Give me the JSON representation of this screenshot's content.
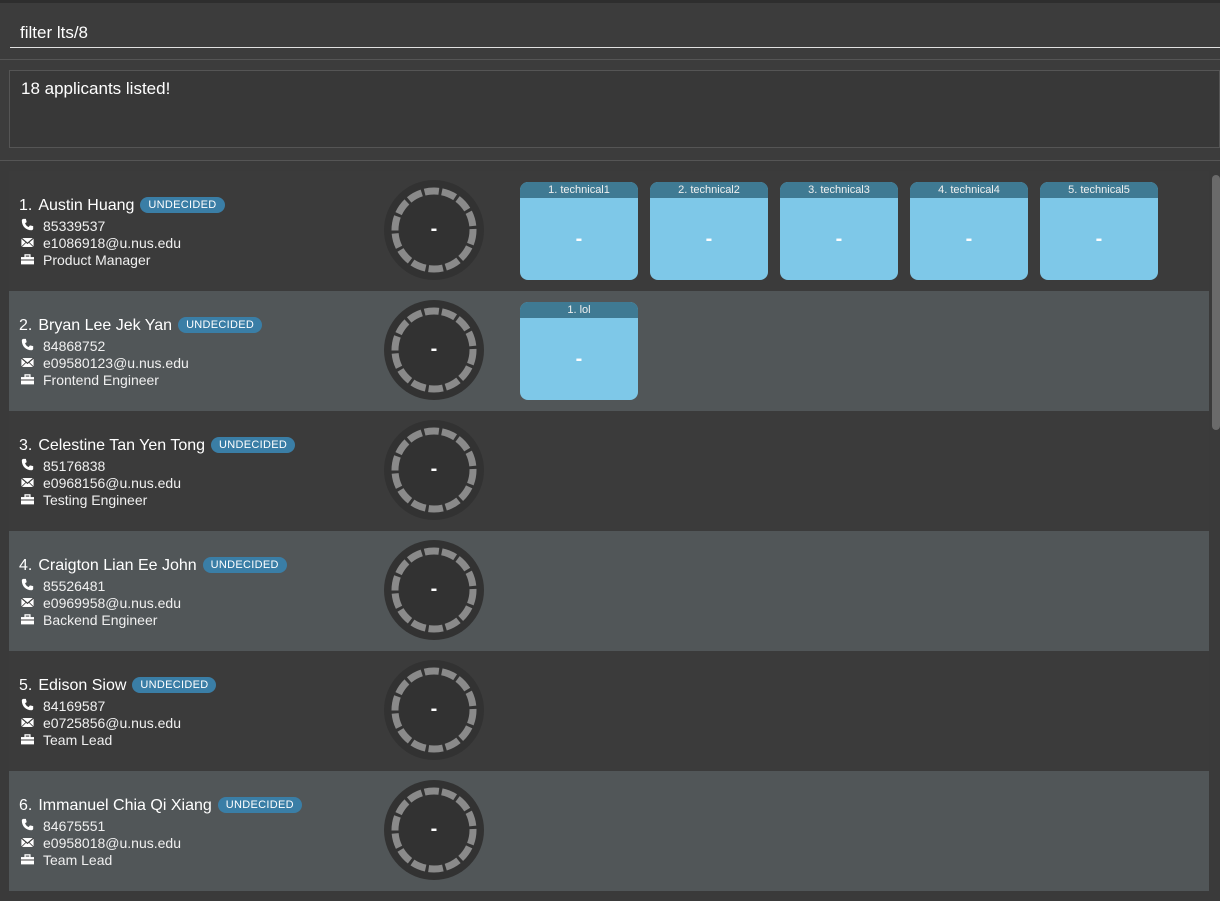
{
  "command": {
    "value": "filter lts/8"
  },
  "result": {
    "text": "18 applicants listed!"
  },
  "applicants": [
    {
      "index": "1.",
      "name": "Austin Huang",
      "status": "UNDECIDED",
      "phone": "85339537",
      "email": "e1086918@u.nus.edu",
      "role": "Product Manager",
      "score": "-",
      "assessments": [
        {
          "title": "1. technical1",
          "value": "-"
        },
        {
          "title": "2. technical2",
          "value": "-"
        },
        {
          "title": "3. technical3",
          "value": "-"
        },
        {
          "title": "4. technical4",
          "value": "-"
        },
        {
          "title": "5. technical5",
          "value": "-"
        }
      ]
    },
    {
      "index": "2.",
      "name": "Bryan Lee Jek Yan",
      "status": "UNDECIDED",
      "phone": "84868752",
      "email": "e09580123@u.nus.edu",
      "role": "Frontend Engineer",
      "score": "-",
      "assessments": [
        {
          "title": "1. lol",
          "value": "-"
        }
      ]
    },
    {
      "index": "3.",
      "name": "Celestine Tan Yen Tong",
      "status": "UNDECIDED",
      "phone": "85176838",
      "email": "e0968156@u.nus.edu",
      "role": "Testing Engineer",
      "score": "-",
      "assessments": []
    },
    {
      "index": "4.",
      "name": "Craigton Lian Ee John",
      "status": "UNDECIDED",
      "phone": "85526481",
      "email": "e0969958@u.nus.edu",
      "role": "Backend Engineer",
      "score": "-",
      "assessments": []
    },
    {
      "index": "5.",
      "name": "Edison Siow",
      "status": "UNDECIDED",
      "phone": "84169587",
      "email": "e0725856@u.nus.edu",
      "role": "Team Lead",
      "score": "-",
      "assessments": []
    },
    {
      "index": "6.",
      "name": "Immanuel Chia Qi Xiang",
      "status": "UNDECIDED",
      "phone": "84675551",
      "email": "e0958018@u.nus.edu",
      "role": "Team Lead",
      "score": "-",
      "assessments": []
    }
  ],
  "icons": {
    "phone": "phone-icon",
    "email": "envelope-icon",
    "role": "briefcase-icon"
  },
  "colors": {
    "badge": "#3a7ea6",
    "scorecard": "#7ec8e8",
    "scorecard_header": "#3f7a93",
    "row_light": "#515658",
    "row_dark": "#3b3b3b"
  }
}
